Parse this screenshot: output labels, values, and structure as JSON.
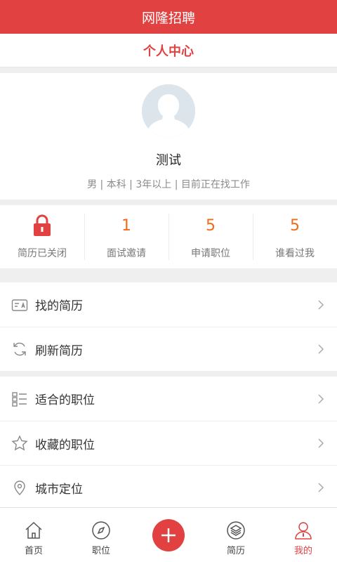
{
  "app": {
    "title": "网隆招聘"
  },
  "header": {
    "title": "个人中心"
  },
  "profile": {
    "name": "测试",
    "info": "男 | 本科 | 3年以上 | 目前正在找工作",
    "avatar_icon": "default-avatar"
  },
  "stats": [
    {
      "value": null,
      "icon": "lock-icon",
      "label": "简历已关闭"
    },
    {
      "value": "1",
      "label": "面试邀请"
    },
    {
      "value": "5",
      "label": "申请职位"
    },
    {
      "value": "5",
      "label": "谁看过我"
    }
  ],
  "menu_group_1": [
    {
      "icon": "resume-card-icon",
      "label": "找的简历"
    },
    {
      "icon": "refresh-icon",
      "label": "刷新简历"
    }
  ],
  "menu_group_2": [
    {
      "icon": "list-icon",
      "label": "适合的职位"
    },
    {
      "icon": "star-icon",
      "label": "收藏的职位"
    },
    {
      "icon": "location-pin-icon",
      "label": "城市定位"
    }
  ],
  "tabbar": {
    "items": [
      {
        "icon": "home-icon",
        "label": "首页"
      },
      {
        "icon": "compass-icon",
        "label": "职位"
      },
      {
        "icon": "plus-icon",
        "label": ""
      },
      {
        "icon": "layers-icon",
        "label": "简历"
      },
      {
        "icon": "user-icon",
        "label": "我的"
      }
    ]
  },
  "colors": {
    "brand": "#e24141",
    "accent": "#f26a1a"
  }
}
